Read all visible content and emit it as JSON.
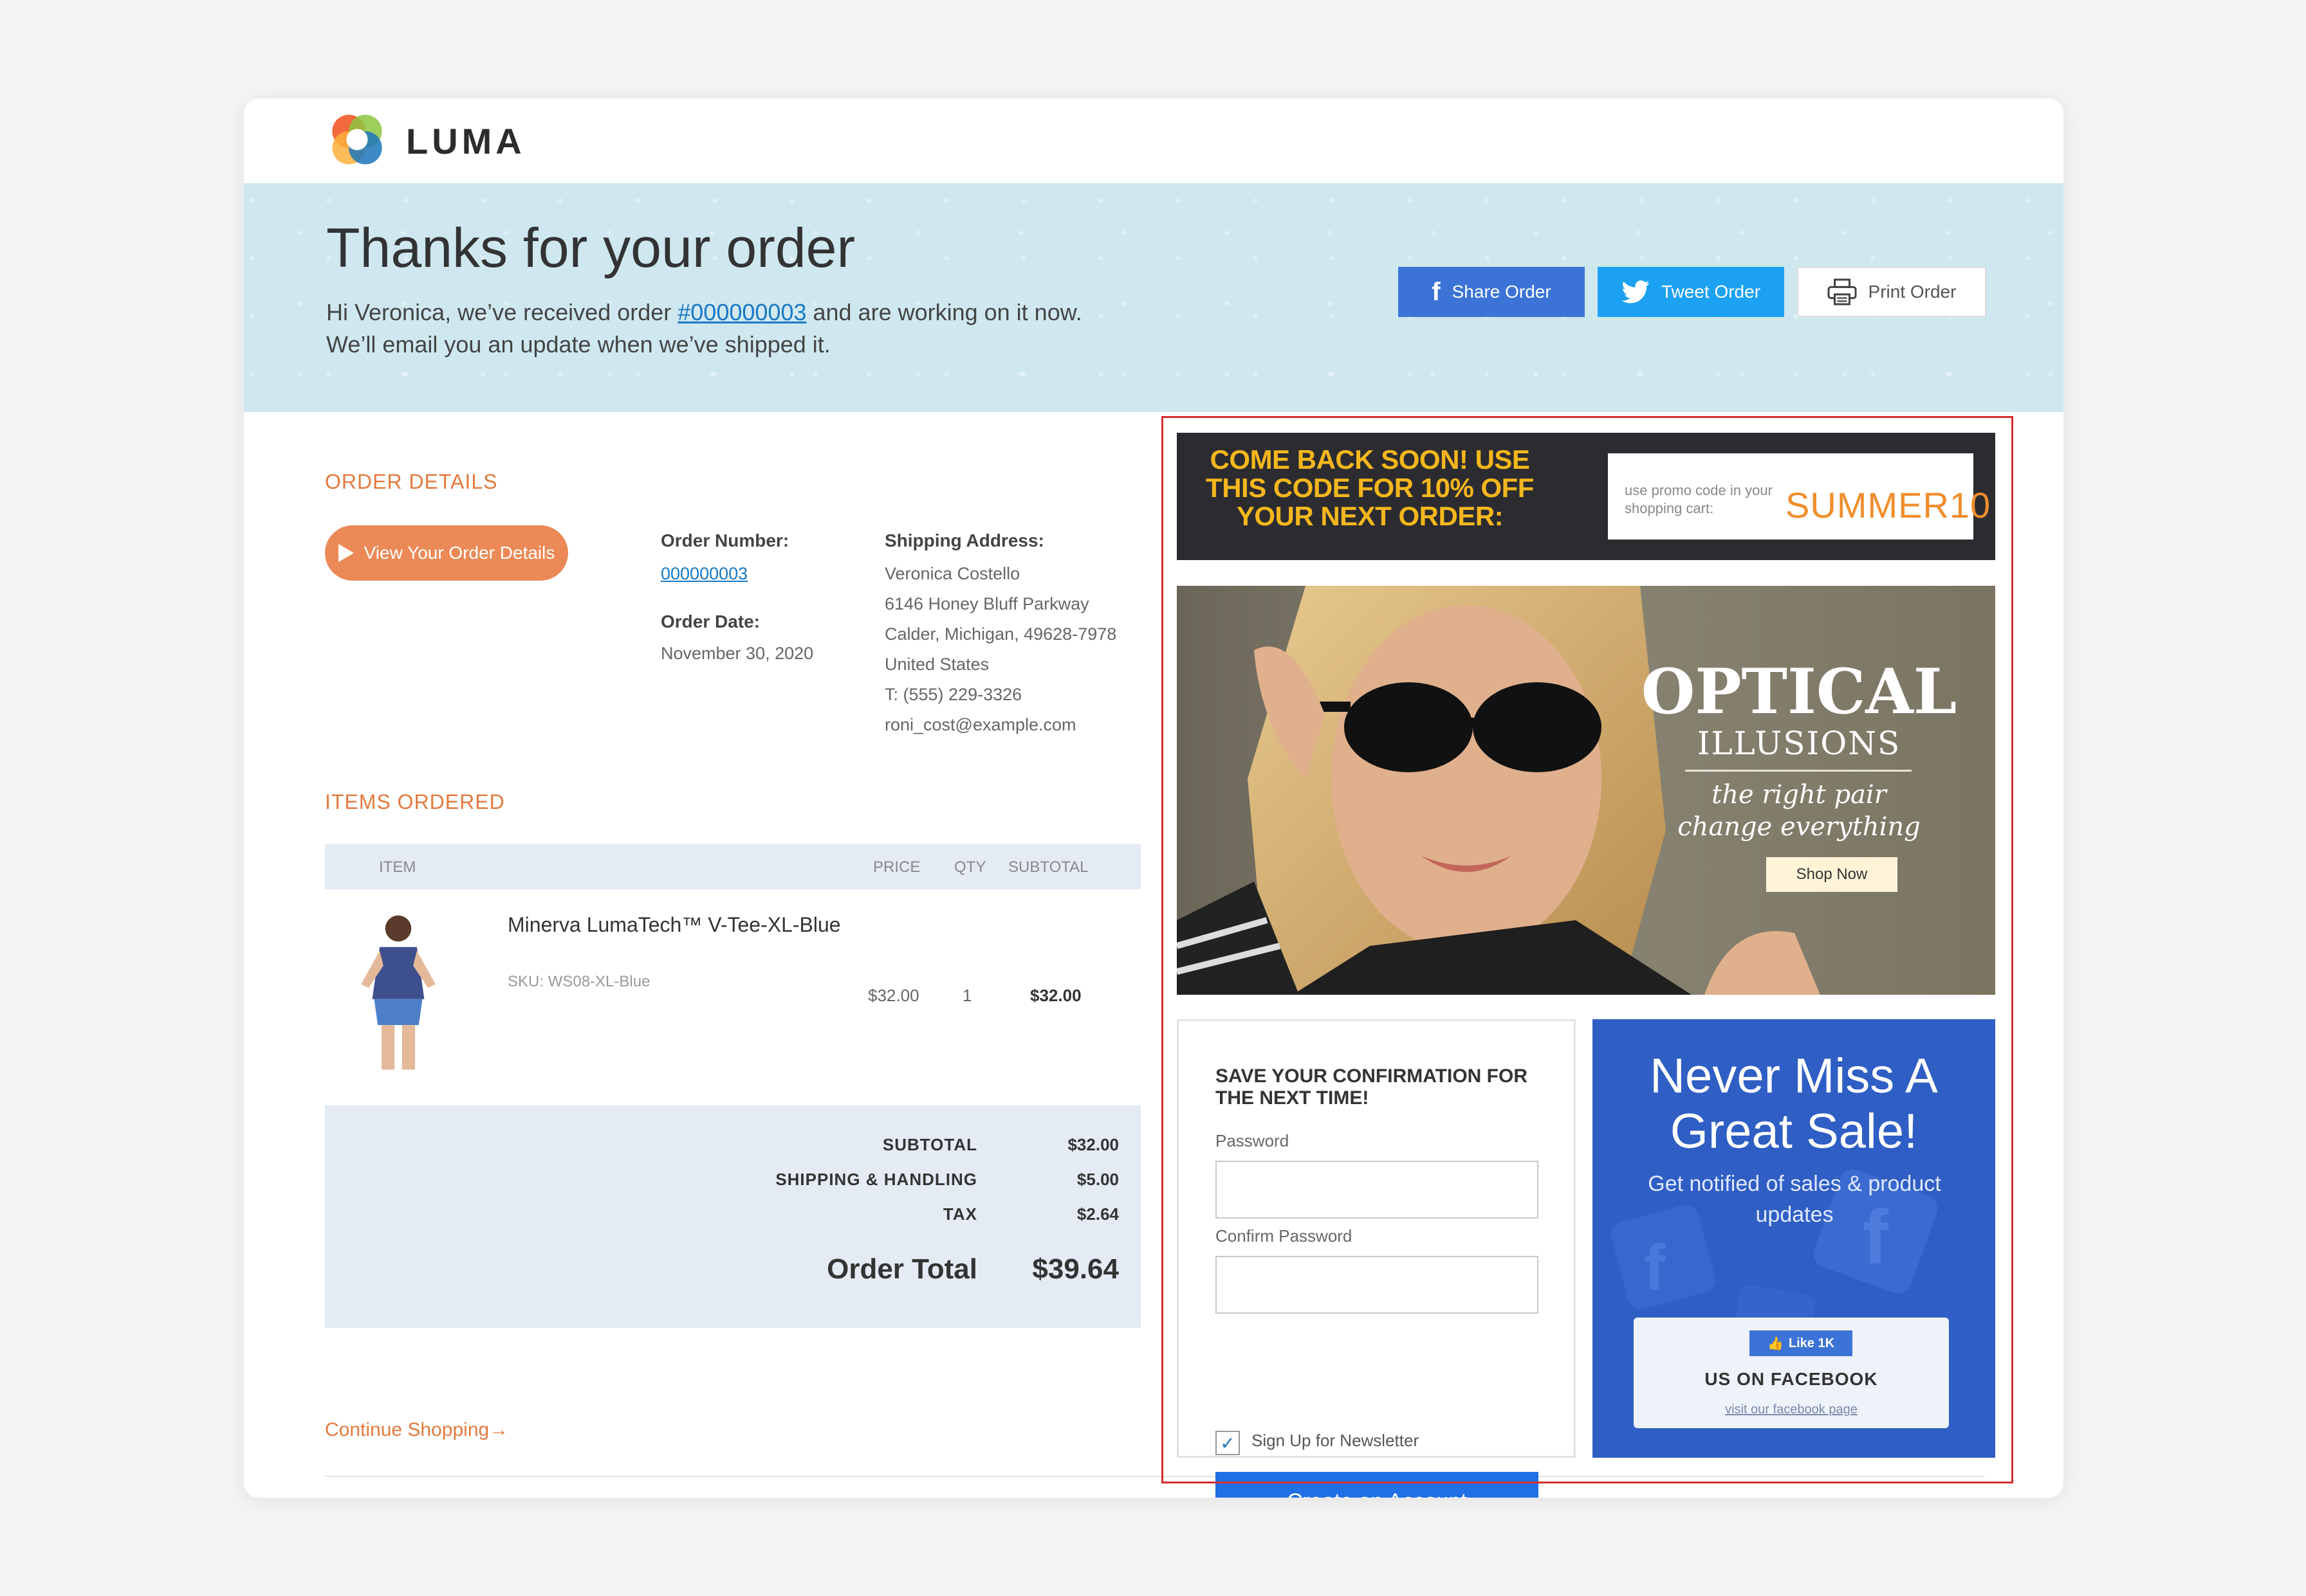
{
  "header": {
    "logo_text": "LUMA"
  },
  "hero": {
    "title": "Thanks for your order",
    "message_pre": "Hi Veronica, we’ve received order ",
    "order_link": "#000000003",
    "message_post": " and are working on it now.",
    "message_line2": "We’ll email you an update when we’ve shipped it.",
    "share_label": "Share Order",
    "tweet_label": "Tweet Order",
    "print_label": "Print Order"
  },
  "order_details": {
    "title": "ORDER DETAILS",
    "view_button": "View Your Order Details",
    "order_number_label": "Order Number:",
    "order_number": "000000003",
    "order_date_label": "Order Date:",
    "order_date": "November 30, 2020",
    "shipping_label": "Shipping Address:",
    "shipping_lines": [
      "Veronica Costello",
      "6146 Honey Bluff Parkway",
      "Calder, Michigan, 49628-7978",
      "United States",
      "T: (555) 229-3326",
      "roni_cost@example.com"
    ]
  },
  "items": {
    "title": "ITEMS ORDERED",
    "headers": {
      "item": "ITEM",
      "price": "PRICE",
      "qty": "QTY",
      "subtotal": "SUBTOTAL"
    },
    "rows": [
      {
        "name": "Minerva LumaTech™ V-Tee-XL-Blue",
        "sku": "SKU: WS08-XL-Blue",
        "price": "$32.00",
        "qty": "1",
        "subtotal": "$32.00"
      }
    ]
  },
  "totals": {
    "subtotal_label": "SUBTOTAL",
    "subtotal": "$32.00",
    "shipping_label": "SHIPPING & HANDLING",
    "shipping": "$5.00",
    "tax_label": "TAX",
    "tax": "$2.64",
    "order_total_label": "Order Total",
    "order_total": "$39.64"
  },
  "continue_shopping": "Continue Shopping→",
  "promo": {
    "line1": "COME BACK SOON! USE",
    "line2": "THIS CODE FOR 10% OFF",
    "line3": "YOUR NEXT ORDER:",
    "small_text": "use promo code in your shopping cart:",
    "code": "SUMMER10"
  },
  "banner": {
    "title": "OPTICAL",
    "subtitle": "ILLUSIONS",
    "tagline1": "the right pair",
    "tagline2": "change everything",
    "button": "Shop Now"
  },
  "account": {
    "title": "SAVE YOUR CONFIRMATION FOR THE NEXT TIME!",
    "password_label": "Password",
    "confirm_label": "Confirm Password",
    "newsletter_label": "Sign Up for Newsletter",
    "newsletter_checked": true,
    "create_button": "Create an Account"
  },
  "facebook": {
    "title": "Never Miss A Great Sale!",
    "subtitle": "Get notified of sales & product updates",
    "like_label": "Like 1K",
    "us_label": "US ON FACEBOOK",
    "visit_label": "visit our facebook page"
  },
  "colors": {
    "accent_orange": "#e27a3f",
    "link_blue": "#1979c3",
    "promo_yellow": "#f5b71d",
    "facebook_blue": "#3b73d6",
    "twitter_blue": "#1da1f2",
    "create_blue": "#1f6fe5",
    "highlight_red": "#d62f2f"
  }
}
